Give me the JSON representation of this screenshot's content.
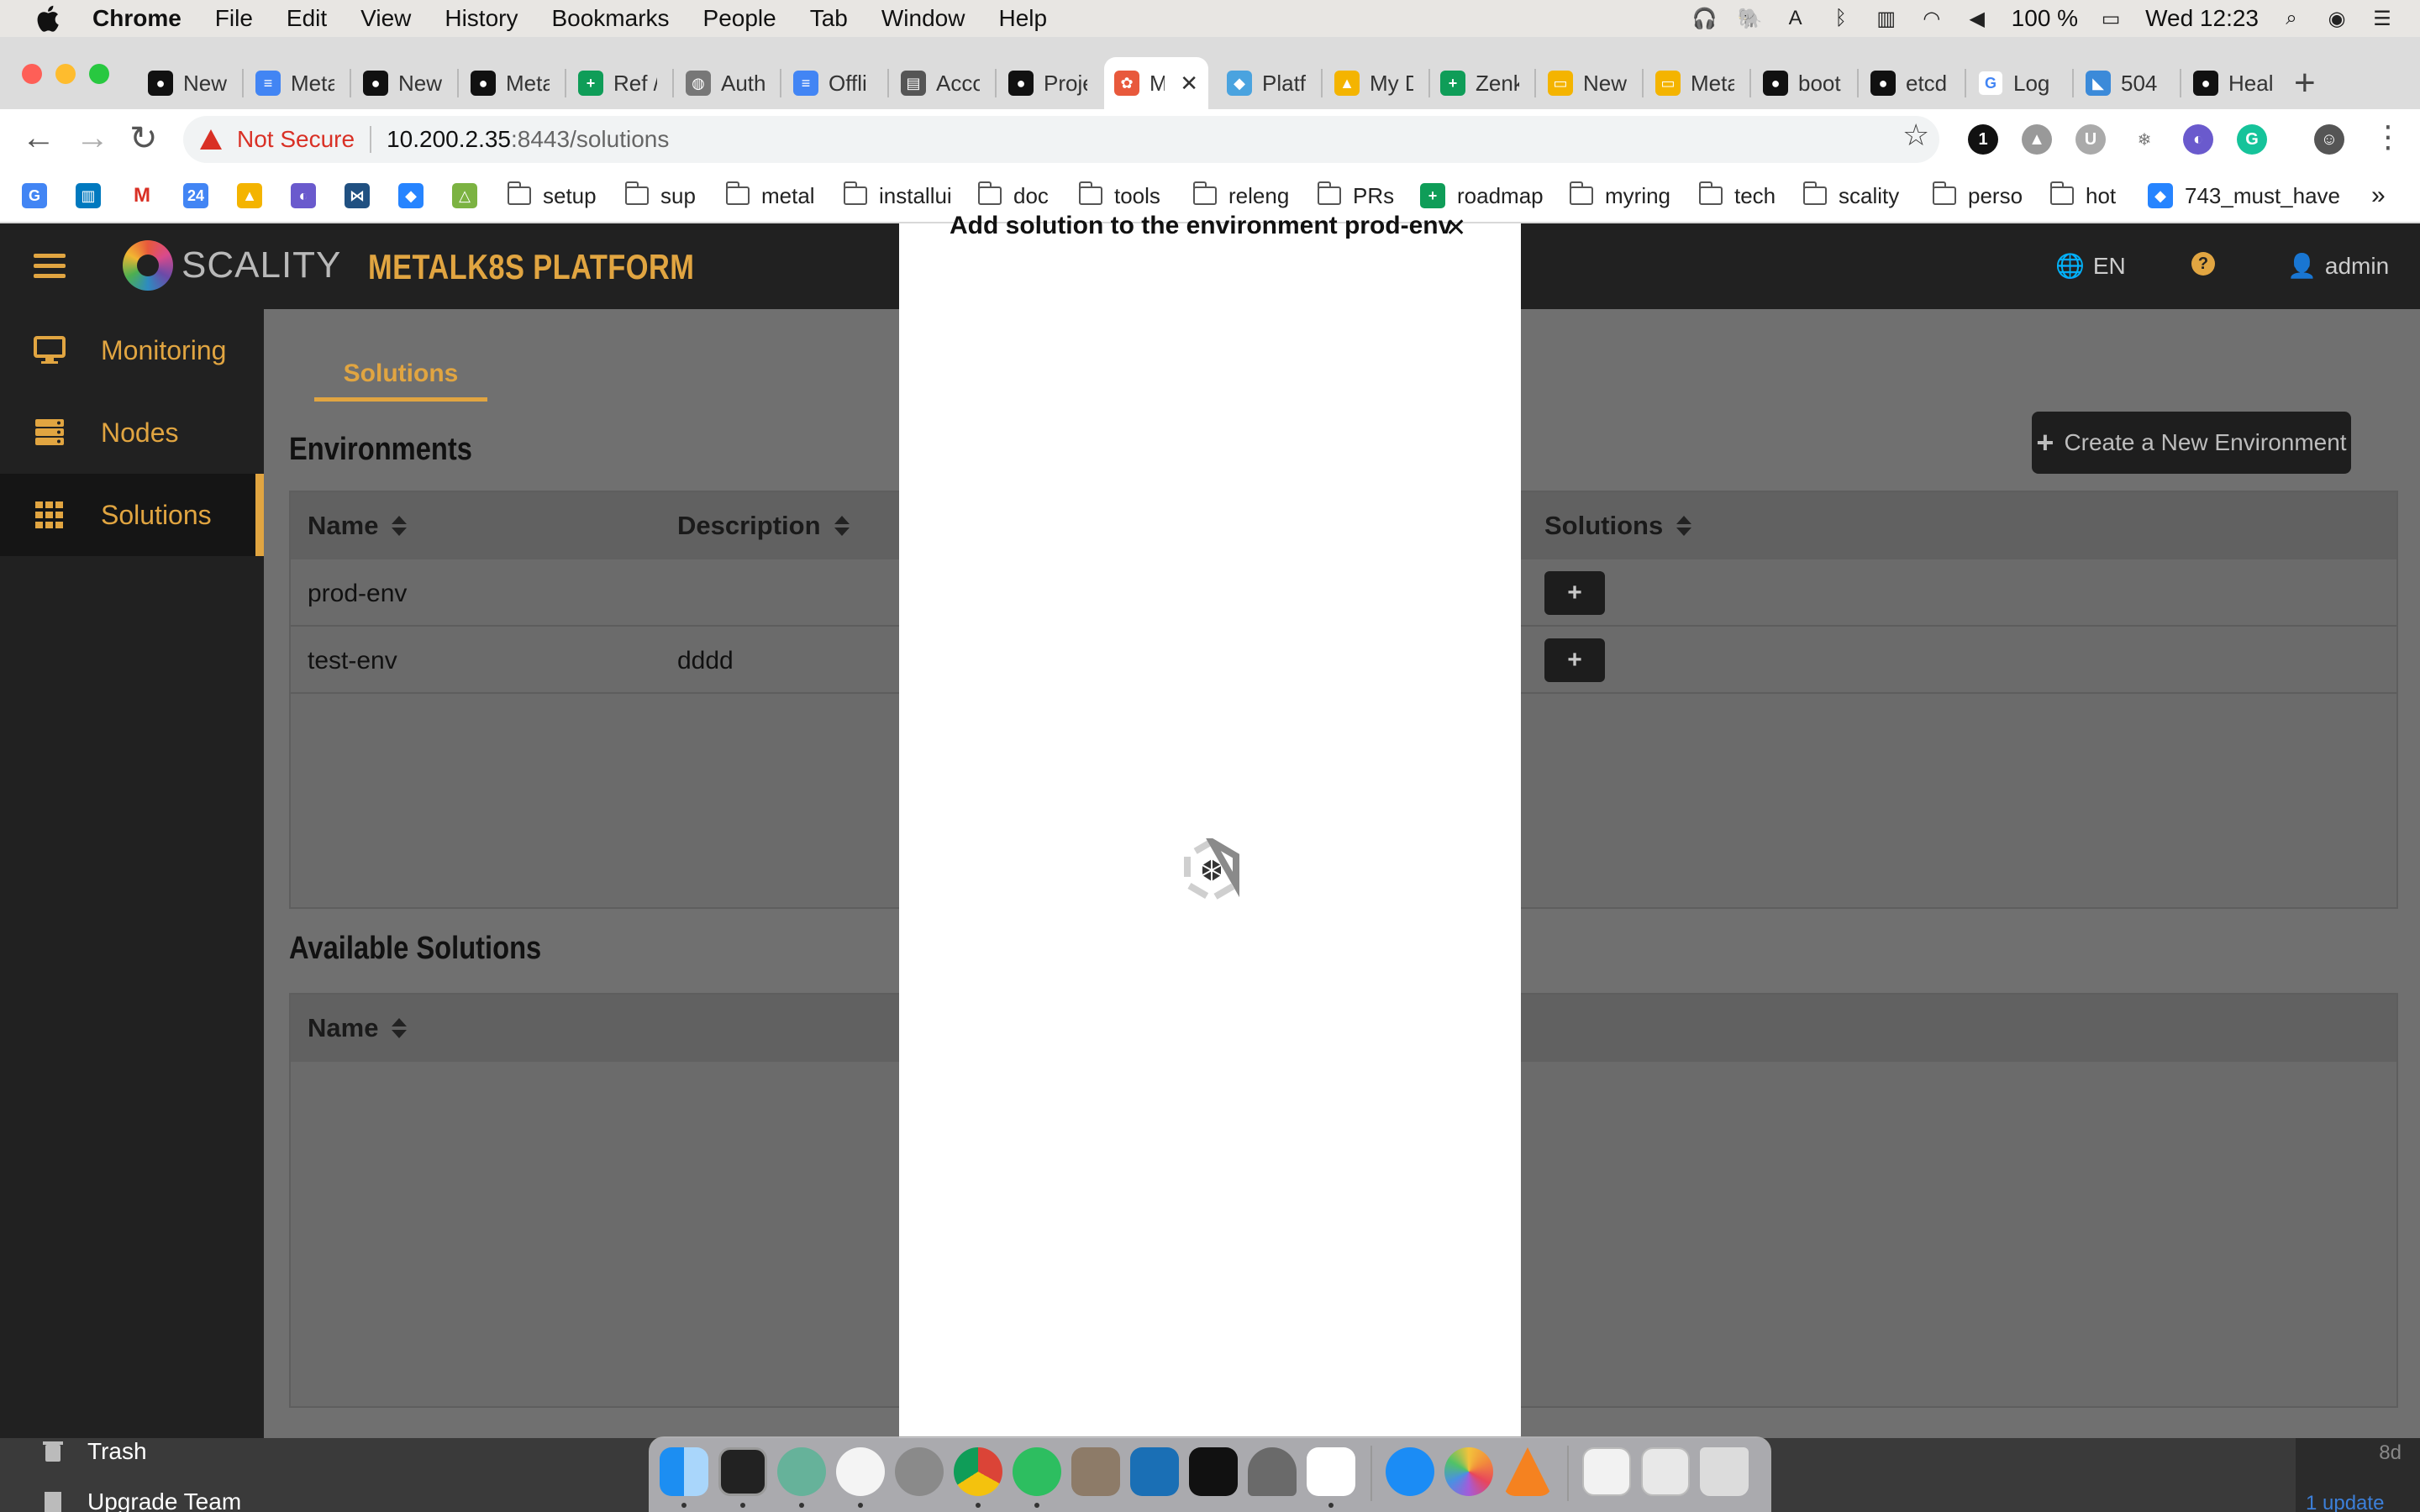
{
  "menubar": {
    "app": "Chrome",
    "items": [
      "File",
      "Edit",
      "View",
      "History",
      "Bookmarks",
      "People",
      "Tab",
      "Window",
      "Help"
    ],
    "battery": "100 %",
    "clock": "Wed 12:23"
  },
  "tabs": [
    {
      "title": "New",
      "icon": "github-icon"
    },
    {
      "title": "Meta",
      "icon": "google-docs-icon"
    },
    {
      "title": "New",
      "icon": "github-icon"
    },
    {
      "title": "Meta",
      "icon": "github-icon"
    },
    {
      "title": "Ref /",
      "icon": "google-sheets-icon"
    },
    {
      "title": "Auth",
      "icon": "globe-icon"
    },
    {
      "title": "Offli",
      "icon": "google-docs-icon"
    },
    {
      "title": "Acco",
      "icon": "document-icon"
    },
    {
      "title": "Proje",
      "icon": "github-icon"
    },
    {
      "title": "M",
      "icon": "scality-icon",
      "active": true
    },
    {
      "title": "Platf",
      "icon": "layers-icon"
    },
    {
      "title": "My D",
      "icon": "google-drive-icon"
    },
    {
      "title": "Zenk",
      "icon": "google-sheets-icon"
    },
    {
      "title": "New",
      "icon": "google-slides-icon"
    },
    {
      "title": "Meta",
      "icon": "google-slides-icon"
    },
    {
      "title": "boot",
      "icon": "github-icon"
    },
    {
      "title": "etcd",
      "icon": "github-icon"
    },
    {
      "title": "Log",
      "icon": "google-icon"
    },
    {
      "title": "504",
      "icon": "shark-icon"
    },
    {
      "title": "Heal",
      "icon": "github-icon"
    }
  ],
  "toolbar": {
    "security": "Not Secure",
    "url_host": "10.200.2.35",
    "url_path": ":8443/solutions"
  },
  "bookmarks": [
    {
      "label": "",
      "type": "app",
      "icon": "google-translate-icon"
    },
    {
      "label": "",
      "type": "app",
      "icon": "trello-icon"
    },
    {
      "label": "",
      "type": "app",
      "icon": "gmail-icon"
    },
    {
      "label": "",
      "type": "app",
      "icon": "calendar-icon"
    },
    {
      "label": "",
      "type": "app",
      "icon": "drive-icon"
    },
    {
      "label": "",
      "type": "app",
      "icon": "scality-app-icon"
    },
    {
      "label": "",
      "type": "app",
      "icon": "confluence-icon"
    },
    {
      "label": "",
      "type": "app",
      "icon": "jira-icon"
    },
    {
      "label": "",
      "type": "app",
      "icon": "cloud-icon"
    },
    {
      "label": "setup",
      "type": "folder"
    },
    {
      "label": "sup",
      "type": "folder"
    },
    {
      "label": "metal",
      "type": "folder"
    },
    {
      "label": "installui",
      "type": "folder"
    },
    {
      "label": "doc",
      "type": "folder"
    },
    {
      "label": "tools",
      "type": "folder"
    },
    {
      "label": "releng",
      "type": "folder"
    },
    {
      "label": "PRs",
      "type": "folder"
    },
    {
      "label": "roadmap",
      "type": "sheet"
    },
    {
      "label": "myring",
      "type": "folder"
    },
    {
      "label": "tech",
      "type": "folder"
    },
    {
      "label": "scality",
      "type": "folder"
    },
    {
      "label": "perso",
      "type": "folder"
    },
    {
      "label": "hot",
      "type": "folder"
    },
    {
      "label": "743_must_have",
      "type": "jira"
    }
  ],
  "app": {
    "brand": "SCALITY",
    "platform": "METALK8S PLATFORM",
    "language": "EN",
    "user": "admin",
    "accent": "#e1a541"
  },
  "sidebar": {
    "items": [
      {
        "label": "Monitoring",
        "icon": "monitor-icon"
      },
      {
        "label": "Nodes",
        "icon": "server-icon"
      },
      {
        "label": "Solutions",
        "icon": "grid-icon",
        "active": true
      }
    ]
  },
  "main": {
    "tab": "Solutions",
    "environments_title": "Environments",
    "create_button": "Create a New Environment",
    "env_columns": [
      "Name",
      "Description",
      "Solutions"
    ],
    "environments": [
      {
        "name": "prod-env",
        "description": ""
      },
      {
        "name": "test-env",
        "description": "dddd"
      }
    ],
    "add_label": "+",
    "available_title": "Available Solutions",
    "available_columns": [
      "Name"
    ]
  },
  "modal": {
    "title": "Add solution to the environment prod-env",
    "close": "✕",
    "state": "loading"
  },
  "finder": {
    "items": [
      "Trash",
      "Upgrade Team"
    ]
  },
  "corner": {
    "text1": "8d",
    "text2": "1 update"
  }
}
